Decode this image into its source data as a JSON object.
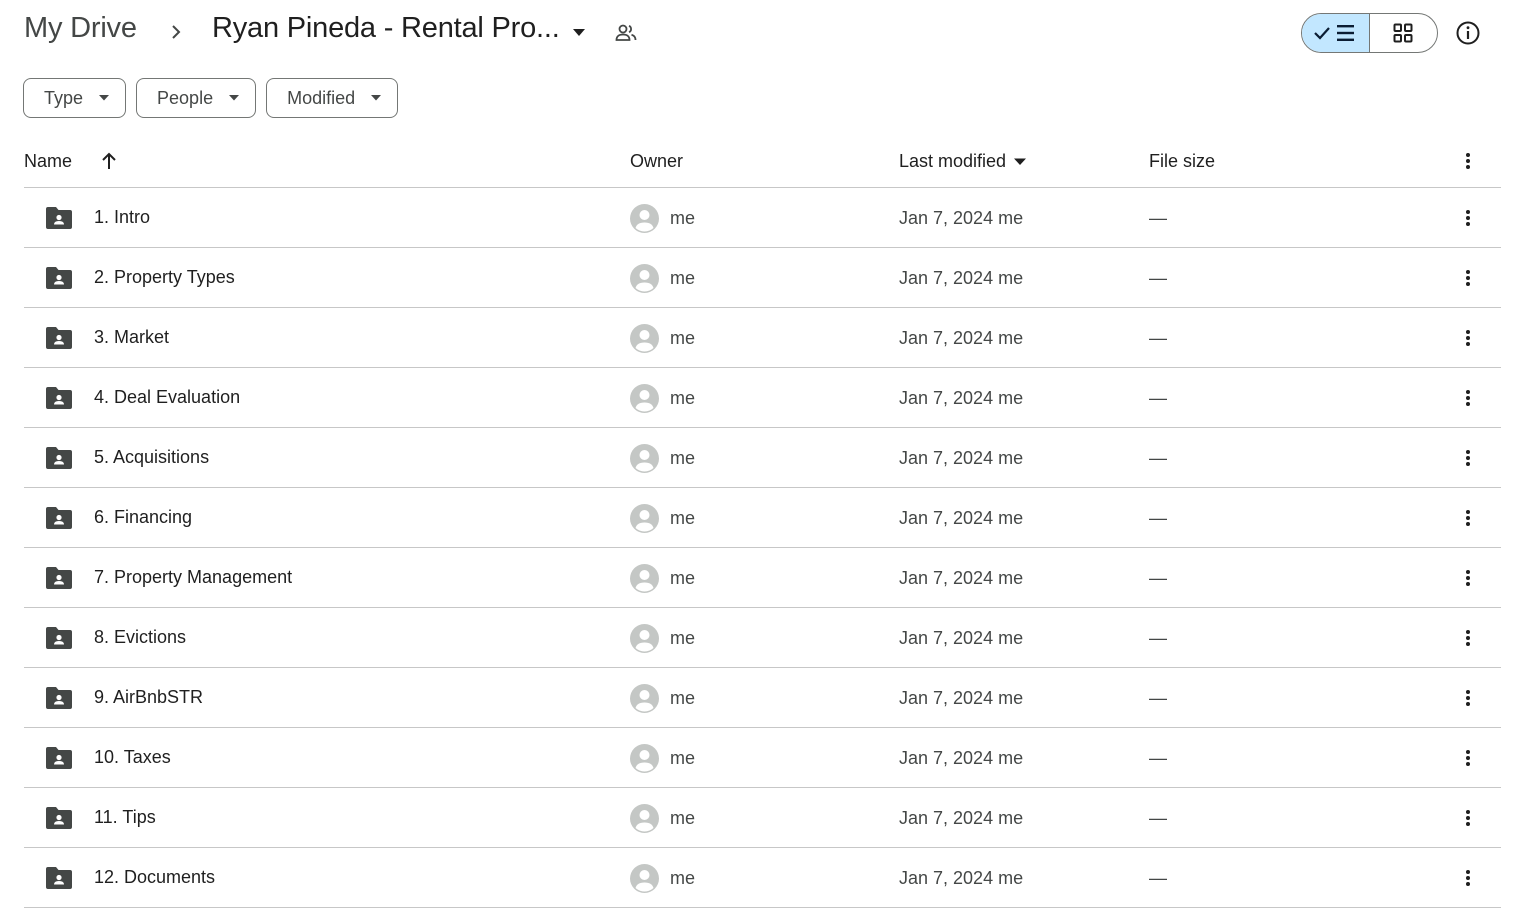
{
  "breadcrumb": {
    "root": "My Drive",
    "separator_icon": "chevron-right-icon",
    "current": "Ryan Pineda - Rental Pro...",
    "current_caret_icon": "caret-down-icon",
    "shared_icon": "people-icon"
  },
  "view_toggle": {
    "list_view": {
      "icon": "check-list-icon",
      "selected": true
    },
    "grid_view": {
      "icon": "grid-icon",
      "selected": false
    }
  },
  "info_icon": "info-icon",
  "filters": [
    {
      "label": "Type"
    },
    {
      "label": "People"
    },
    {
      "label": "Modified"
    }
  ],
  "table": {
    "columns": {
      "name": "Name",
      "owner": "Owner",
      "last_modified": "Last modified",
      "file_size": "File size"
    },
    "sort": {
      "column": "Name",
      "direction": "ascending"
    },
    "rows": [
      {
        "name": "1. Intro",
        "owner": "me",
        "modified": "Jan 7, 2024 me",
        "size": "—"
      },
      {
        "name": "2. Property Types",
        "owner": "me",
        "modified": "Jan 7, 2024 me",
        "size": "—"
      },
      {
        "name": "3. Market",
        "owner": "me",
        "modified": "Jan 7, 2024 me",
        "size": "—"
      },
      {
        "name": "4. Deal Evaluation",
        "owner": "me",
        "modified": "Jan 7, 2024 me",
        "size": "—"
      },
      {
        "name": "5. Acquisitions",
        "owner": "me",
        "modified": "Jan 7, 2024 me",
        "size": "—"
      },
      {
        "name": "6. Financing",
        "owner": "me",
        "modified": "Jan 7, 2024 me",
        "size": "—"
      },
      {
        "name": "7. Property Management",
        "owner": "me",
        "modified": "Jan 7, 2024 me",
        "size": "—"
      },
      {
        "name": "8. Evictions",
        "owner": "me",
        "modified": "Jan 7, 2024 me",
        "size": "—"
      },
      {
        "name": "9. AirBnbSTR",
        "owner": "me",
        "modified": "Jan 7, 2024 me",
        "size": "—"
      },
      {
        "name": "10. Taxes",
        "owner": "me",
        "modified": "Jan 7, 2024 me",
        "size": "—"
      },
      {
        "name": "11. Tips",
        "owner": "me",
        "modified": "Jan 7, 2024 me",
        "size": "—"
      },
      {
        "name": "12. Documents",
        "owner": "me",
        "modified": "Jan 7, 2024 me",
        "size": "—"
      }
    ]
  },
  "colors": {
    "toggle_active_bg": "#c2e7ff",
    "text_primary": "#1f1f1f",
    "text_secondary": "#444746",
    "divider": "#c7c7c7",
    "folder_icon": "#444746",
    "avatar": "#c4c7c5"
  }
}
